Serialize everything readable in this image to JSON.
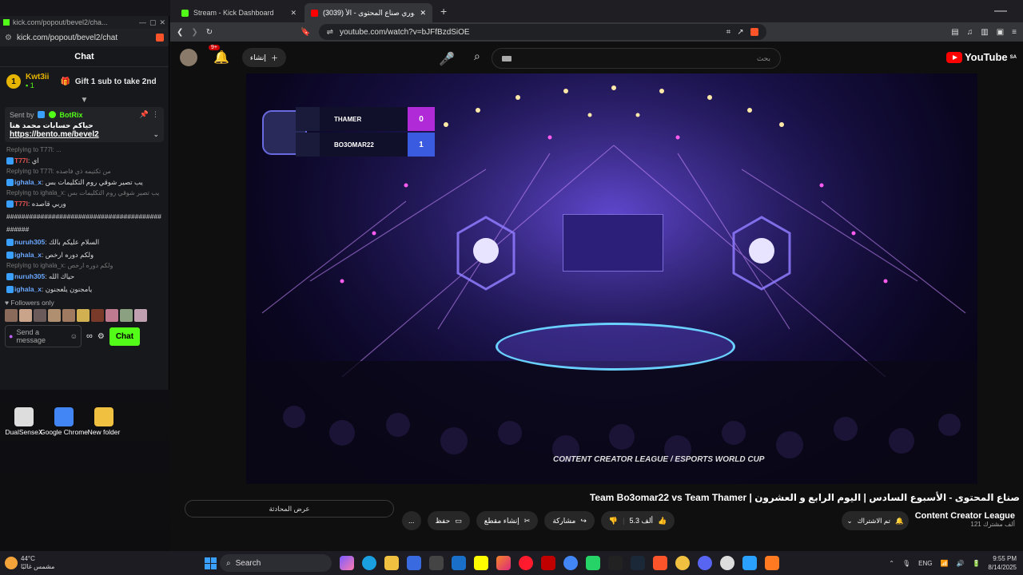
{
  "kick": {
    "window_title": "kick.com/popout/bevel2/cha...",
    "url": "kick.com/popout/bevel2/chat",
    "chat_header": "Chat",
    "gift": {
      "rank": "1",
      "user": "Kwt3ii",
      "count": "1",
      "text": "Gift 1 sub to take 2nd"
    },
    "pinned": {
      "sent_by_label": "Sent by",
      "sender": "BotRix",
      "message": "حياكم حسابات محمد هنا",
      "link": "https://bento.me/bevel2"
    },
    "messages": [
      {
        "kind": "reply",
        "text": "Replying to T77l: ..."
      },
      {
        "kind": "msg",
        "user": "T77l",
        "user_color": "#e05050",
        "text": "اي"
      },
      {
        "kind": "reply",
        "text": "Replying to T77l: من تكتيمه ذي فاصده"
      },
      {
        "kind": "msg",
        "user": "ighala_x",
        "user_color": "#6aa8ff",
        "text": "يب تصير شوقي روم التكليمات بس"
      },
      {
        "kind": "reply",
        "text": "Replying to ighala_x: يب تصير شوقي روم التكليمات بس"
      },
      {
        "kind": "msg",
        "user": "T77l",
        "user_color": "#e05050",
        "text": "وربي قاصده"
      },
      {
        "kind": "msg",
        "user": "",
        "user_color": "#dddddd",
        "text": "#########################################"
      },
      {
        "kind": "msg",
        "user": "",
        "user_color": "#dddddd",
        "text": "######"
      },
      {
        "kind": "msg",
        "user": "nuruh305",
        "user_color": "#6aa8ff",
        "text": "السلام عليكم بالك"
      },
      {
        "kind": "msg",
        "user": "ighala_x",
        "user_color": "#6aa8ff",
        "text": "ولكم دوره ارخص"
      },
      {
        "kind": "reply",
        "text": "Replying to ighala_x: ولكم دوره ارخص"
      },
      {
        "kind": "msg",
        "user": "nuruh305",
        "user_color": "#6aa8ff",
        "text": "حياك الله"
      },
      {
        "kind": "msg",
        "user": "ighala_x",
        "user_color": "#6aa8ff",
        "text": "يامجنون يلعجنون"
      }
    ],
    "followers_only": "Followers only",
    "send_placeholder": "Send a message",
    "chat_button": "Chat"
  },
  "desktop_icons": [
    {
      "label": "DualSenseX",
      "color": "#dddddd"
    },
    {
      "label": "Google Chrome",
      "color": "#4285f4"
    },
    {
      "label": "New folder",
      "color": "#f0c040"
    }
  ],
  "browser": {
    "tabs": [
      {
        "title": "Stream - Kick Dashboard",
        "icon_color": "#53fc18",
        "active": false
      },
      {
        "title": "(3039) دوري صناع المحتوى - الأ...",
        "icon_color": "#ff0000",
        "active": true
      }
    ],
    "new_tab": "+",
    "url": "youtube.com/watch?v=bJFfBzdSiOE"
  },
  "youtube": {
    "notif_count": "9+",
    "create_label": "إنشاء",
    "search_placeholder": "بحث",
    "logo_text": "YouTube",
    "logo_region": "SA",
    "scoreboard": [
      {
        "team": "THAMER",
        "score": "0",
        "score_color": "#b02ad8"
      },
      {
        "team": "BO3OMAR22",
        "score": "1",
        "score_color": "#3a5ae0"
      }
    ],
    "sponsor_text": "CONTENT CREATOR LEAGUE / ESPORTS WORLD CUP",
    "video_title": "صناع المحتوى - الأسبوع السادس | اليوم الرابع و العشرون | Team Bo3omar22 vs Team Thamer",
    "show_chat": "عرض المحادثة",
    "actions": {
      "like_count": "5.3 ألف",
      "share": "مشاركة",
      "clip": "إنشاء مقطع",
      "save": "حفظ",
      "more": "..."
    },
    "subscribed": "تم الاشتراك",
    "channel_name": "Content Creator League",
    "subscribers": "121 ألف مشترك"
  },
  "taskbar": {
    "temp": "44°C",
    "weather_desc": "مشمس غالبًا",
    "search": "Search",
    "lang": "ENG",
    "time": "9:55 PM",
    "date": "8/14/2025"
  }
}
